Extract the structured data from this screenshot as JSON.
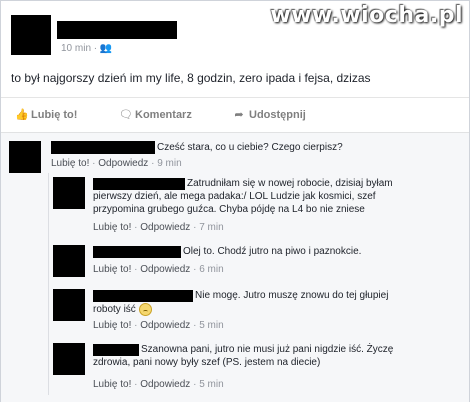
{
  "watermark": "www.wiocha.pl",
  "post": {
    "time": "10 min",
    "audience_icon": "friends-icon",
    "text": "to był najgorszy dzień im my life, 8 godzin, zero ipada i fejsa, dzizas"
  },
  "actions": {
    "like": "Lubię to!",
    "comment": "Komentarz",
    "share": "Udostępnij"
  },
  "comments": [
    {
      "text": "Cześć stara, co u ciebie? Czego cierpisz?",
      "like": "Lubię to!",
      "reply": "Odpowiedz",
      "time": "9 min"
    },
    {
      "line1": "Zatrudniłam się w nowej robocie, dzisiaj byłam",
      "line2": "pierwszy dzień, ale mega padaka:/ LOL Ludzie jak kosmici, szef",
      "line3": "przypomina grubego guźca. Chyba pójdę na L4 bo nie zniese",
      "like": "Lubię to!",
      "reply": "Odpowiedz",
      "time": "7 min"
    },
    {
      "text": "Olej to. Chodź jutro na piwo i paznokcie.",
      "like": "Lubię to!",
      "reply": "Odpowiedz",
      "time": "6 min"
    },
    {
      "line1": "Nie mogę. Jutro muszę znowu do tej głupiej",
      "line2": "roboty iść",
      "like": "Lubię to!",
      "reply": "Odpowiedz",
      "time": "5 min"
    },
    {
      "line1": "Szanowna pani, jutro nie musi już pani nigdzie iść. Życzę",
      "line2": "zdrowia, pani nowy były szef (PS. jestem na diecie)",
      "like": "Lubię to!",
      "reply": "Odpowiedz",
      "time": "5 min"
    }
  ],
  "colors": {
    "link": "#4b4f56",
    "meta": "#90949c",
    "comment_bg": "#f6f7f9"
  }
}
